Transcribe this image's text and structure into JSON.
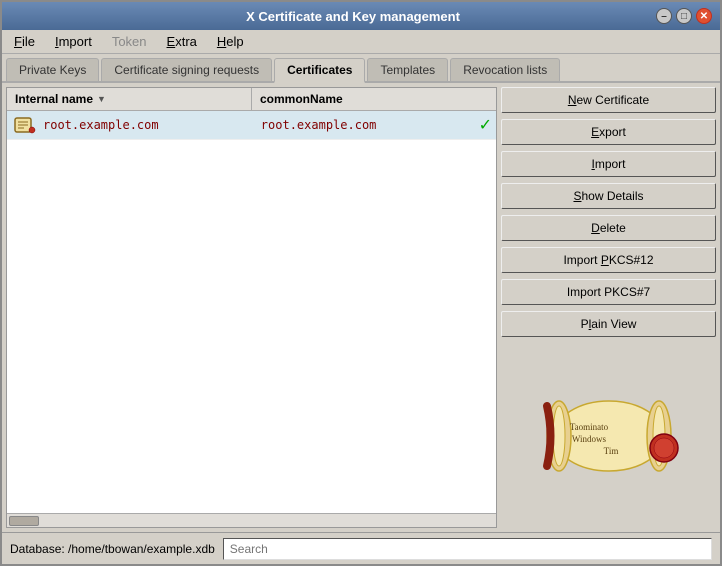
{
  "window": {
    "title": "X Certificate and Key management"
  },
  "titlebar": {
    "minimize_label": "–",
    "maximize_label": "□",
    "close_label": "✕"
  },
  "menubar": {
    "items": [
      {
        "label": "File",
        "underline": "F",
        "id": "file"
      },
      {
        "label": "Import",
        "underline": "I",
        "id": "import"
      },
      {
        "label": "Token",
        "underline": "T",
        "id": "token"
      },
      {
        "label": "Extra",
        "underline": "E",
        "id": "extra"
      },
      {
        "label": "Help",
        "underline": "H",
        "id": "help"
      }
    ]
  },
  "tabs": [
    {
      "label": "Private Keys",
      "id": "private-keys",
      "active": false
    },
    {
      "label": "Certificate signing requests",
      "id": "csr",
      "active": false
    },
    {
      "label": "Certificates",
      "id": "certificates",
      "active": true
    },
    {
      "label": "Templates",
      "id": "templates",
      "active": false
    },
    {
      "label": "Revocation lists",
      "id": "revocation",
      "active": false
    }
  ],
  "table": {
    "col1_header": "Internal name",
    "col2_header": "commonName",
    "rows": [
      {
        "internal_name": "root.example.com",
        "common_name": "root.example.com",
        "verified": true
      }
    ]
  },
  "buttons": [
    {
      "label": "New Certificate",
      "underline": "N",
      "id": "new-cert"
    },
    {
      "label": "Export",
      "underline": "E",
      "id": "export"
    },
    {
      "label": "Import",
      "underline": "I",
      "id": "import"
    },
    {
      "label": "Show Details",
      "underline": "S",
      "id": "show-details"
    },
    {
      "label": "Delete",
      "underline": "D",
      "id": "delete"
    },
    {
      "label": "Import PKCS#12",
      "underline": "P",
      "id": "import-pkcs12"
    },
    {
      "label": "Import PKCS#7",
      "underline": "P",
      "id": "import-pkcs7"
    },
    {
      "label": "Plain View",
      "underline": "l",
      "id": "plain-view"
    }
  ],
  "statusbar": {
    "database_label": "Database: /home/tbowan/example.xdb",
    "search_placeholder": "Search"
  }
}
